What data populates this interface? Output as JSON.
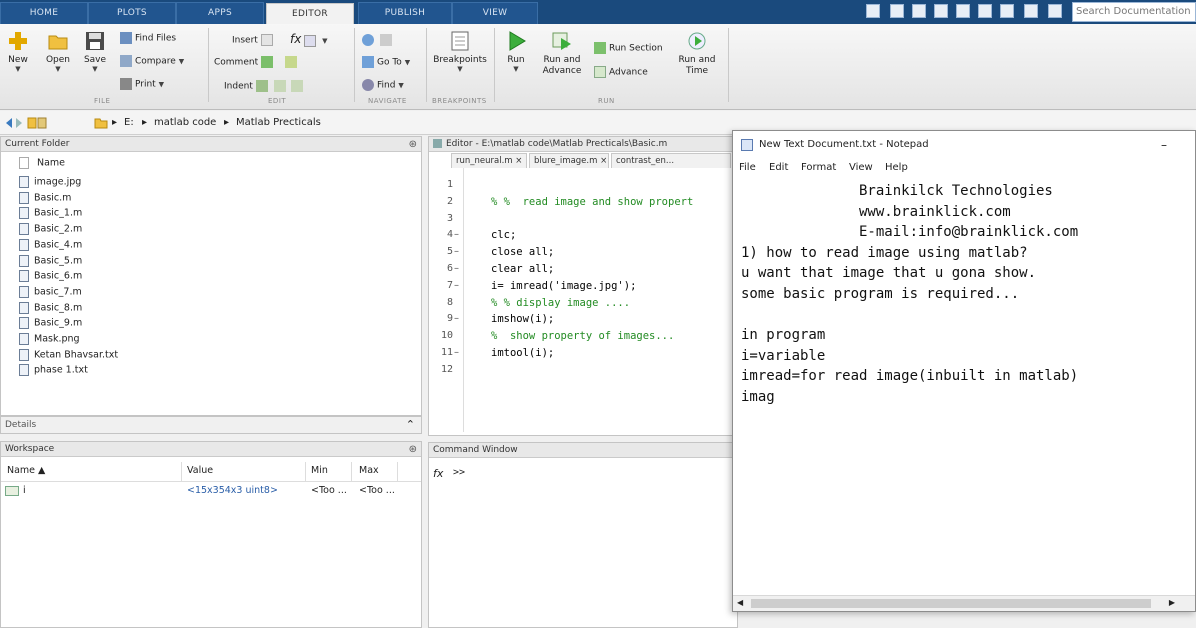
{
  "tabs": [
    "HOME",
    "PLOTS",
    "APPS",
    "EDITOR",
    "PUBLISH",
    "VIEW"
  ],
  "active_tab": "EDITOR",
  "search_placeholder": "Search Documentation",
  "ribbon": {
    "file": {
      "new": "New",
      "open": "Open",
      "save": "Save",
      "find_files": "Find Files",
      "compare": "Compare",
      "print": "Print",
      "group": "FILE"
    },
    "edit": {
      "insert": "Insert",
      "comment": "Comment",
      "indent": "Indent",
      "fx": "fx",
      "group": "EDIT"
    },
    "navigate": {
      "go_to": "Go To",
      "find": "Find",
      "group": "NAVIGATE"
    },
    "breakpoints": {
      "label": "Breakpoints",
      "group": "BREAKPOINTS"
    },
    "run": {
      "run": "Run",
      "run_and_advance": "Run and Advance",
      "run_section": "Run Section",
      "advance": "Advance",
      "run_and_time": "Run and Time",
      "group": "RUN"
    }
  },
  "address": {
    "drive": "E:",
    "folder1": "matlab code",
    "folder2": "Matlab Precticals"
  },
  "current_folder": {
    "title": "Current Folder",
    "column": "Name",
    "files": [
      "image.jpg",
      "Basic.m",
      "Basic_1.m",
      "Basic_2.m",
      "Basic_4.m",
      "Basic_5.m",
      "Basic_6.m",
      "basic_7.m",
      "Basic_8.m",
      "Basic_9.m",
      "Mask.png",
      "Ketan Bhavsar.txt",
      "phase 1.txt"
    ]
  },
  "details": {
    "title": "Details"
  },
  "workspace": {
    "title": "Workspace",
    "columns": [
      "Name ▲",
      "Value",
      "Min",
      "Max"
    ],
    "rows": [
      [
        "i",
        "<15x354x3 uint8>",
        "<Too ...",
        "<Too ..."
      ]
    ]
  },
  "editor": {
    "title": "Editor - E:\\matlab code\\Matlab Precticals\\Basic.m",
    "tabs": [
      "run_neural.m",
      "blure_image.m",
      "contrast_en..."
    ],
    "lines": [
      {
        "n": "1",
        "text": "",
        "dash": false
      },
      {
        "n": "2",
        "text": "% %  read image and show propert",
        "dash": false
      },
      {
        "n": "3",
        "text": "",
        "dash": false
      },
      {
        "n": "4",
        "text": "clc;",
        "dash": true
      },
      {
        "n": "5",
        "text": "close all;",
        "dash": true
      },
      {
        "n": "6",
        "text": "clear all;",
        "dash": true
      },
      {
        "n": "7",
        "text": "i= imread('image.jpg');",
        "dash": true
      },
      {
        "n": "8",
        "text": "% % display image ....",
        "dash": false
      },
      {
        "n": "9",
        "text": "imshow(i);",
        "dash": true
      },
      {
        "n": "10",
        "text": "%  show property of images...",
        "dash": false
      },
      {
        "n": "11",
        "text": "imtool(i);",
        "dash": true
      },
      {
        "n": "12",
        "text": "",
        "dash": false
      }
    ]
  },
  "command_window": {
    "title": "Command Window",
    "prompt": ">>"
  },
  "notepad": {
    "title": "New Text Document.txt - Notepad",
    "menu": [
      "File",
      "Edit",
      "Format",
      "View",
      "Help"
    ],
    "text": "              Brainkilck Technologies\n              www.brainklick.com\n              E-mail:info@brainklick.com\n1) how to read image using matlab?\nu want that image that u gona show.\nsome basic program is required...\n\nin program\ni=variable\nimread=for read image(inbuilt in matlab)\nimag"
  },
  "colors": {
    "titlebar": "#1a4a7d",
    "comment": "#228b22",
    "string": "#a020f0",
    "keyword_text": "#000000"
  }
}
